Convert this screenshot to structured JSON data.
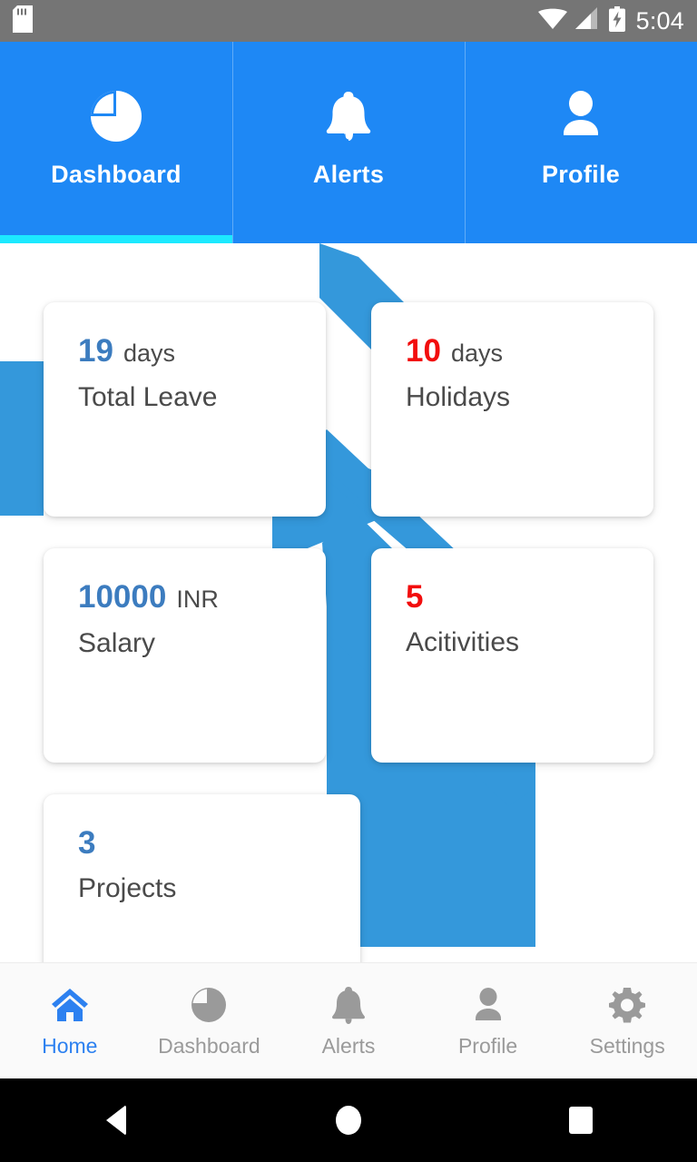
{
  "status_bar": {
    "time": "5:04",
    "icons": {
      "sd_card": "sd-card-icon",
      "wifi": "wifi-icon",
      "signal": "cellular-signal-icon",
      "battery": "battery-charging-icon"
    }
  },
  "top_tabs": {
    "active_index": 0,
    "items": [
      {
        "label": "Dashboard",
        "icon": "pie-chart-icon"
      },
      {
        "label": "Alerts",
        "icon": "bell-icon"
      },
      {
        "label": "Profile",
        "icon": "person-icon"
      }
    ]
  },
  "dashboard_cards": [
    {
      "value": "19",
      "unit": "days",
      "label": "Total Leave",
      "value_color": "#3c7cbf"
    },
    {
      "value": "10",
      "unit": "days",
      "label": "Holidays",
      "value_color": "#f20d0d"
    },
    {
      "value": "10000",
      "unit": "INR",
      "label": "Salary",
      "value_color": "#3c7cbf"
    },
    {
      "value": "5",
      "unit": "",
      "label": "Acitivities",
      "value_color": "#f20d0d"
    },
    {
      "value": "3",
      "unit": "",
      "label": "Projects",
      "value_color": "#3c7cbf"
    }
  ],
  "bottom_nav": {
    "active_index": 0,
    "items": [
      {
        "label": "Home",
        "icon": "home-icon"
      },
      {
        "label": "Dashboard",
        "icon": "pie-chart-icon"
      },
      {
        "label": "Alerts",
        "icon": "bell-icon"
      },
      {
        "label": "Profile",
        "icon": "person-icon"
      },
      {
        "label": "Settings",
        "icon": "gear-icon"
      }
    ]
  },
  "system_nav": {
    "back": "back-button",
    "home": "home-button",
    "recents": "recents-button"
  },
  "colors": {
    "tab_bar_blue": "#1e88f5",
    "active_indicator_cyan": "#1ce9ff",
    "background_art_blue": "#3498db",
    "accent_blue": "#3c7cbf",
    "accent_red": "#f20d0d",
    "status_bar_gray": "#757575",
    "nav_inactive_gray": "#9a9a9a",
    "nav_active_blue": "#2d81f0"
  }
}
